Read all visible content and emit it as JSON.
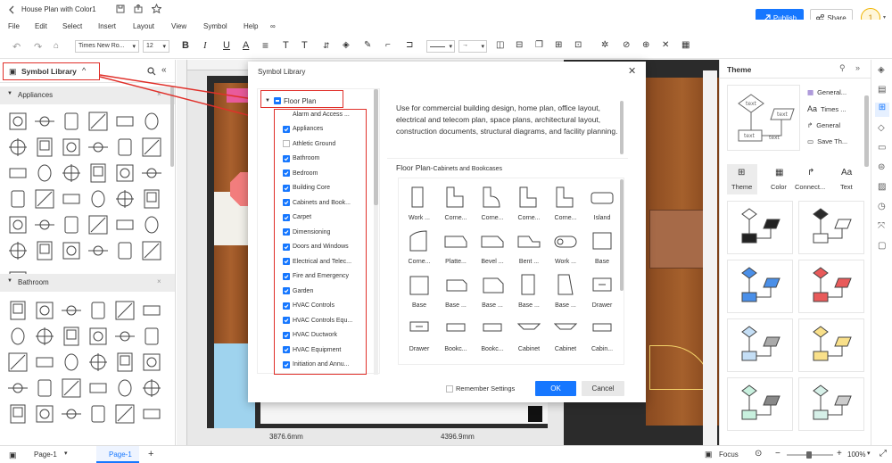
{
  "window": {
    "title": "House Plan with Color1"
  },
  "menu": [
    "File",
    "Edit",
    "Select",
    "Insert",
    "Layout",
    "View",
    "Symbol",
    "Help"
  ],
  "header": {
    "publish": "Publish",
    "share": "Share",
    "avatar": "1"
  },
  "toolbar": {
    "font": "Times New Ro...",
    "size": "12"
  },
  "library": {
    "title": "Symbol Library",
    "cat1": "Appliances",
    "cat2": "Bathroom"
  },
  "canvas": {
    "dim1": "3876.6mm",
    "dim2": "4396.9mm"
  },
  "dialog": {
    "title": "Symbol Library",
    "root": "Floor Plan",
    "items": [
      {
        "label": "Alarm and Access ...",
        "checked": true
      },
      {
        "label": "Appliances",
        "checked": true
      },
      {
        "label": "Athletic Ground",
        "checked": false
      },
      {
        "label": "Bathroom",
        "checked": true
      },
      {
        "label": "Bedroom",
        "checked": true
      },
      {
        "label": "Building Core",
        "checked": true
      },
      {
        "label": "Cabinets and Book...",
        "checked": true
      },
      {
        "label": "Carpet",
        "checked": true
      },
      {
        "label": "Dimensioning",
        "checked": true
      },
      {
        "label": "Doors and Windows",
        "checked": true
      },
      {
        "label": "Electrical and Telec...",
        "checked": true
      },
      {
        "label": "Fire and Emergency",
        "checked": true
      },
      {
        "label": "Garden",
        "checked": true
      },
      {
        "label": "HVAC Controls",
        "checked": true
      },
      {
        "label": "HVAC Controls Equ...",
        "checked": true
      },
      {
        "label": "HVAC Ductwork",
        "checked": true
      },
      {
        "label": "HVAC Equipment",
        "checked": true
      },
      {
        "label": "Initiation and Annu...",
        "checked": true
      }
    ],
    "description": "Use for commercial building design, home plan, office layout, electrical and telecom plan, space plans, architectural layout, construction documents, structural diagrams, and facility planning.",
    "section_main": "Floor Plan-",
    "section_sub": "Cabinets and Bookcases",
    "shapes": [
      "Work ...",
      "Corne...",
      "Corne...",
      "Corne...",
      "Corne...",
      "Island",
      "Corne...",
      "Platte...",
      "Bevel ...",
      "Bent ...",
      "Work ...",
      "Base",
      "Base",
      "Base ...",
      "Base ...",
      "Base ...",
      "Base ...",
      "Drawer",
      "Drawer",
      "Bookc...",
      "Bookc...",
      "Cabinet",
      "Cabinet",
      "Cabin..."
    ],
    "remember": "Remember Settings",
    "ok": "OK",
    "cancel": "Cancel"
  },
  "theme": {
    "title": "Theme",
    "opts": [
      "General...",
      "Times ...",
      "General",
      "Save Th..."
    ],
    "tabs": [
      "Theme",
      "Color",
      "Connect...",
      "Text"
    ]
  },
  "status": {
    "page_sel": "Page-1",
    "page_tab": "Page-1",
    "focus": "Focus",
    "zoom": "100%"
  }
}
